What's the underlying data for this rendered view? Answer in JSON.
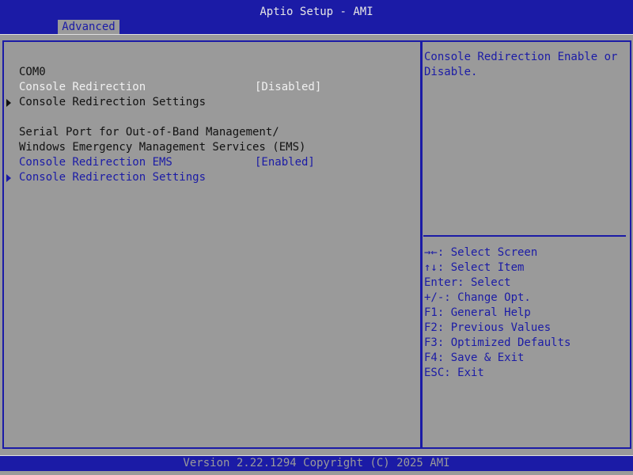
{
  "header": {
    "title": "Aptio Setup - AMI"
  },
  "tabs": [
    {
      "label": "Advanced",
      "active": true
    }
  ],
  "main": {
    "com0_heading": "COM0",
    "console_redirection": {
      "label": "Console Redirection",
      "value": "[Disabled]"
    },
    "console_redirection_settings_1": "Console Redirection Settings",
    "serial_port_line1": "Serial Port for Out-of-Band Management/",
    "serial_port_line2": "Windows Emergency Management Services (EMS)",
    "console_redirection_ems": {
      "label": "Console Redirection EMS",
      "value": "[Enabled]"
    },
    "console_redirection_settings_2": "Console Redirection Settings"
  },
  "help": {
    "description_line1": "Console Redirection Enable or",
    "description_line2": "Disable.",
    "keys": [
      "→←: Select Screen",
      "↑↓: Select Item",
      "Enter: Select",
      "+/-: Change Opt.",
      "F1: General Help",
      "F2: Previous Values",
      "F3: Optimized Defaults",
      "F4: Save & Exit",
      "ESC: Exit"
    ]
  },
  "footer": {
    "text": "Version 2.22.1294 Copyright (C) 2025 AMI"
  },
  "colors": {
    "background": "#9a9a9a",
    "accent": "#1b1ba6",
    "highlight": "#f0f0f0"
  }
}
